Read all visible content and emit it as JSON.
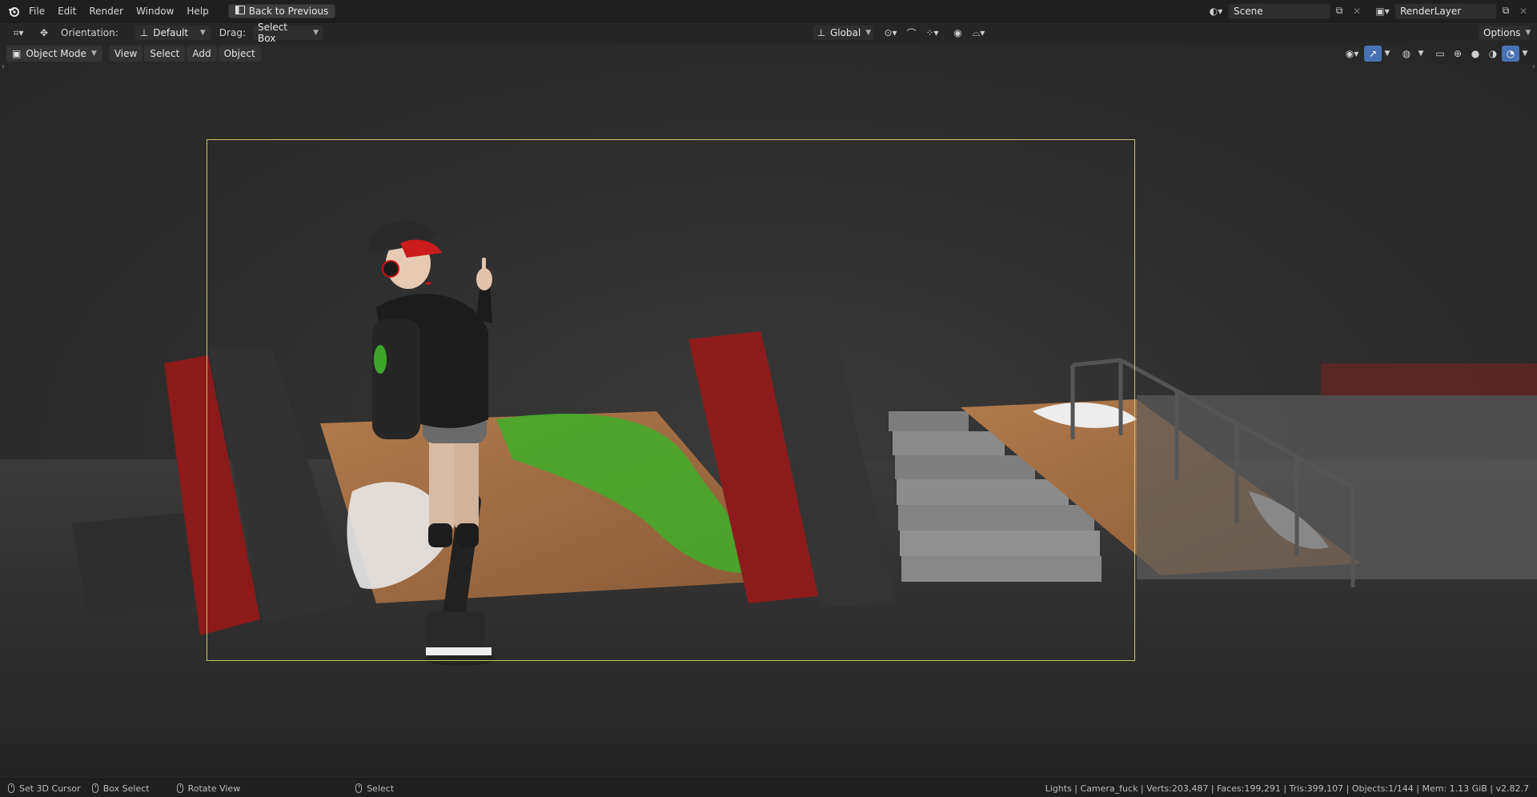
{
  "topbar": {
    "menus": [
      "File",
      "Edit",
      "Render",
      "Window",
      "Help"
    ],
    "back_button": "Back to Previous",
    "scene_name": "Scene",
    "render_layer": "RenderLayer"
  },
  "toolbar": {
    "orientation_label": "Orientation:",
    "orientation_value": "Default",
    "drag_label": "Drag:",
    "drag_value": "Select Box",
    "transform_orientation": "Global",
    "options_label": "Options"
  },
  "header": {
    "mode": "Object Mode",
    "menus": [
      "View",
      "Select",
      "Add",
      "Object"
    ]
  },
  "statusbar": {
    "left_click": "Set 3D Cursor",
    "drag": "Box Select",
    "middle": "Rotate View",
    "right": "Select",
    "stats": "Lights | Camera_fuck | Verts:203,487 | Faces:199,291 | Tris:399,107 | Objects:1/144 | Mem: 1.13 GiB | v2.82.7"
  },
  "colors": {
    "camera_frame": "#c8c46a",
    "active_blue": "#4772b3"
  },
  "icons": {
    "app": "blender-logo-icon",
    "back": "back-window-icon",
    "scene_type": "scene-type-icon",
    "new_scene": "new-scene-icon",
    "close": "close-icon"
  }
}
